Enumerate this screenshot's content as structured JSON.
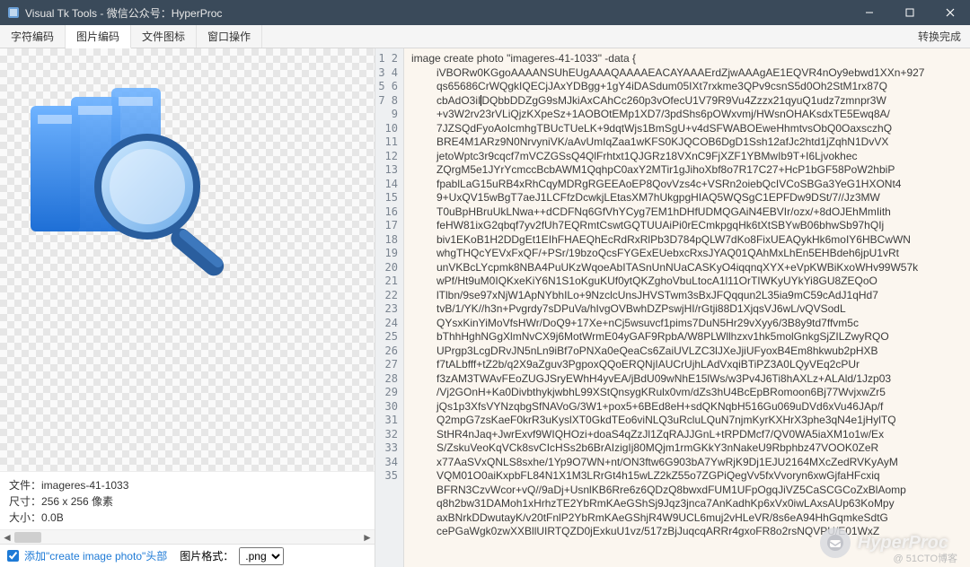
{
  "window": {
    "title": "Visual Tk Tools - 微信公众号：HyperProc"
  },
  "tabs": {
    "t0": "字符编码",
    "t1": "图片编码",
    "t2": "文件图标",
    "t3": "窗口操作"
  },
  "status": {
    "right_text": "转换完成"
  },
  "info": {
    "file_label": "文件：",
    "file_name": "imageres-41-1033",
    "size_label": "尺寸：",
    "size_value": "256 x 256 像素",
    "bytes_label": "大小：",
    "bytes_value": "0.0B"
  },
  "footer": {
    "checkbox_label": "添加\"create image photo\"头部",
    "format_label": "图片格式：",
    "format_value": ".png"
  },
  "code": {
    "header": "image create photo \"imageres-41-1033\" -data {",
    "lines": [
      "iVBORw0KGgoAAAANSUhEUgAAAQAAAAEACAYAAAErdZjwAAAgAE1EQVR4nOy9ebwd1XXn+927",
      "qs65686CrWQgkIQECjJAxYDBgg+1gY4iDASdum05IXt7rxkme3QPv9csnS5d0Oh2StM1rx87Q",
      "cbAdO3iIDQbbDDZgG9sMJkiAxCAhCc260p3vOfecU1V79R9Vu4Zzzx21qyuQ1udz7zmnpr3W",
      "+v3W2rv23rVLiQjzKXpeSz+1AOBOtEMp1XD7/3pdShs6pOWxvmj/HWsnOHAKsdxTE5Ewq8A/",
      "7JZSQdFyoAoIcmhgTBUcTUeLK+9dqtWjs1BmSgU+v4dSFWABOEweHhmtvsObQ0OaxsczhQ",
      "BRE4M1ARz9N0NrvyniVK/aAvUmIqZaa1wKFS0KJQCOB6DgD1Ssh12afJc2htd1jZqhN1DvVX",
      "jetoWptc3r9cqcf7mVCZGSsQ4QlFrhtxt1QJGRz18VXnC9FjXZF1YBMwIb9T+I6Ljvokhec",
      "ZQrgM5e1JYrYcmccBcbAWM1QqhpC0axY2MTir1gJihoXbf8o7R17C27+HcP1bGF58PoW2hbiP",
      "fpablLaG15uRB4xRhCqyMDRgRGEEAoEP8QovVzs4c+VSRn2oiebQcIVCoSBGa3YeG1HXONt4",
      "9+UxQV15wBgT7aeJ1LCFfzDcwkjLEtasXM7hUkgpgHIAQ5WQSgC1EPFDw9DSt/7//Jz3MW",
      "T0uBpHBruUkLNwa++dCDFNq6GfVhYCyg7EM1hDHfUDMQGAiN4EBVIr/ozx/+8dOJEhMmIith",
      "feHW81ixG2qbqf7yv2fUh7EQRmtCswtGQTUUAiPi0rECmkpgqHk6tXtSBYwB06bhwSb97hQIj",
      "biv1EKoB1H2DDgEt1EIhFHAEQhEcRdRxRlPb3D784pQLW7dKo8FixUEAQykHk6moIY6HBCwWN",
      "whgTHQcYEVxFxQF/+PSr/19bzoQcsFYGExEUebxcRxsJYAQ01QAhMxLhEn5EHBdeh6jpU1vRt",
      "unVKBcLYcpmk8NBA4PuUKzWqoeAbITASnUnNUaCASKyO4iqqnqXYX+eVpKWBiKxoWHv99W57k",
      "wPf/Ht9uM0IQKxeKiY6N1S1oKguKUf0ytQKZghoVbuLtocA1l11OrTIWKyUYkYi8GU8ZEQoO",
      "lTlbn/9se97xNjW1ApNYbhILo+9NzclcUnsJHVSTwm3sBxJFQqqun2L35ia9mC59cAdJ1qHd7",
      "tvB/1/YK//h3n+Pvgrdy7sDPuVa/hIvgOVBwhDZPswjHI/rGtji88D1XjqsVJ6wL/vQVSodL",
      "QYsxKinYiMoVfsHWr/DoQ9+17Xe+nCj5wsuvcf1pims7DuN5Hr29vXyy6/3B8y9td7ffvm5c",
      "bThhHghNGgXlmNvCX9j6MotWrmE04yGAF9RpbA/W8PLWllhzxv1hk5molGnkgSjZILZwyRQO",
      "UPrgp3LcgDRvJN5nLn9iBf7oPNXa0eQeaCs6ZaiUVLZC3lJXeJjiUFyoxB4Em8hkwub2pHXB",
      "f7tALbfff+tZ2b/q2X9aZguv3PgpoxQQoERQNjIAUCrUjhLAdVxqiBTiPZ3A0LQyVEq2cPUr",
      "f3zAM3TWAvFEoZUGJSryEWhH4yvEA/jBdU09wNhE15lWs/w3Pv4J6Ti8hAXLz+ALAld/1Jzp03",
      "/Vj2GOnH+Ka0DivbthykjwbhL99XStQnsygKRulx0vm/dZs3hU4BcEpBRomoon6Bj77WvjxwZr5",
      "jQs1p3XfsVYNzqbgSfNAVoG/3W1+pox5+6BEd8eH+sdQKNqbH516Gu069uDVd6xVu46JAp/f",
      "Q2mpG7zsKaeF0krR3uKyslXT0GkdTEo6viNLQ3uRcluLQuN7njmKyrKXHrX3phe3qN4e1jHylTQ",
      "StHR4nJaq+JwrExvf9WIQHOzi+doaS4qZzJl1ZqRAJJGnL+tRPDMcf7/QV0WA5iaXM1o1w/Ex",
      "S/ZskuVeoKqVCk8svCIcHSs2b6BrAIzigIj80MQjm1rmGKkY3nNakeU9Rbphbz47VOOK0ZeR",
      "x77AaSVxQNLS8sxhe/1Yp9O7WN+nt/ON3ftw6G903bA7YwRjK9Dj1EJU2164MXcZedRVKyAyM",
      "VQM01O0aiKxpbFL84N1X1M3LRrGt4h15wLZ2kZ55o7ZGPiQegVv5fxVvoryn6xwGjfaHFcxiq",
      "BFRN3CzvWcor+vQ//9aDj+UsnlKB6Rre6z6QDzQ8bwxdFUM1UFpOgqJiVZ5CaSCGCoZxBlAomp",
      "q8h2bw31DAMoh1xHrhzTE2YbRmKAeGShSj9Jqz3jnca7AnKadhKp6xVx0iwLAxsAUp63KoMpy",
      "axBNrkDDwutayK/v20tFnlP2YbRmKAeGShjR4W9UCL6muj2vHLeVR/8s6eA94HhGqmkeSdtG",
      "cePGaWgk0zwXXBllUIRTQZD0jExkuU1vz/517zBjJuqcqARRr4gxoFR8o2rsNQVPU/E01WxZ"
    ]
  },
  "line_count": 35,
  "watermark": {
    "text": "HyperProc"
  },
  "footnote": "@ 51CTO博客"
}
